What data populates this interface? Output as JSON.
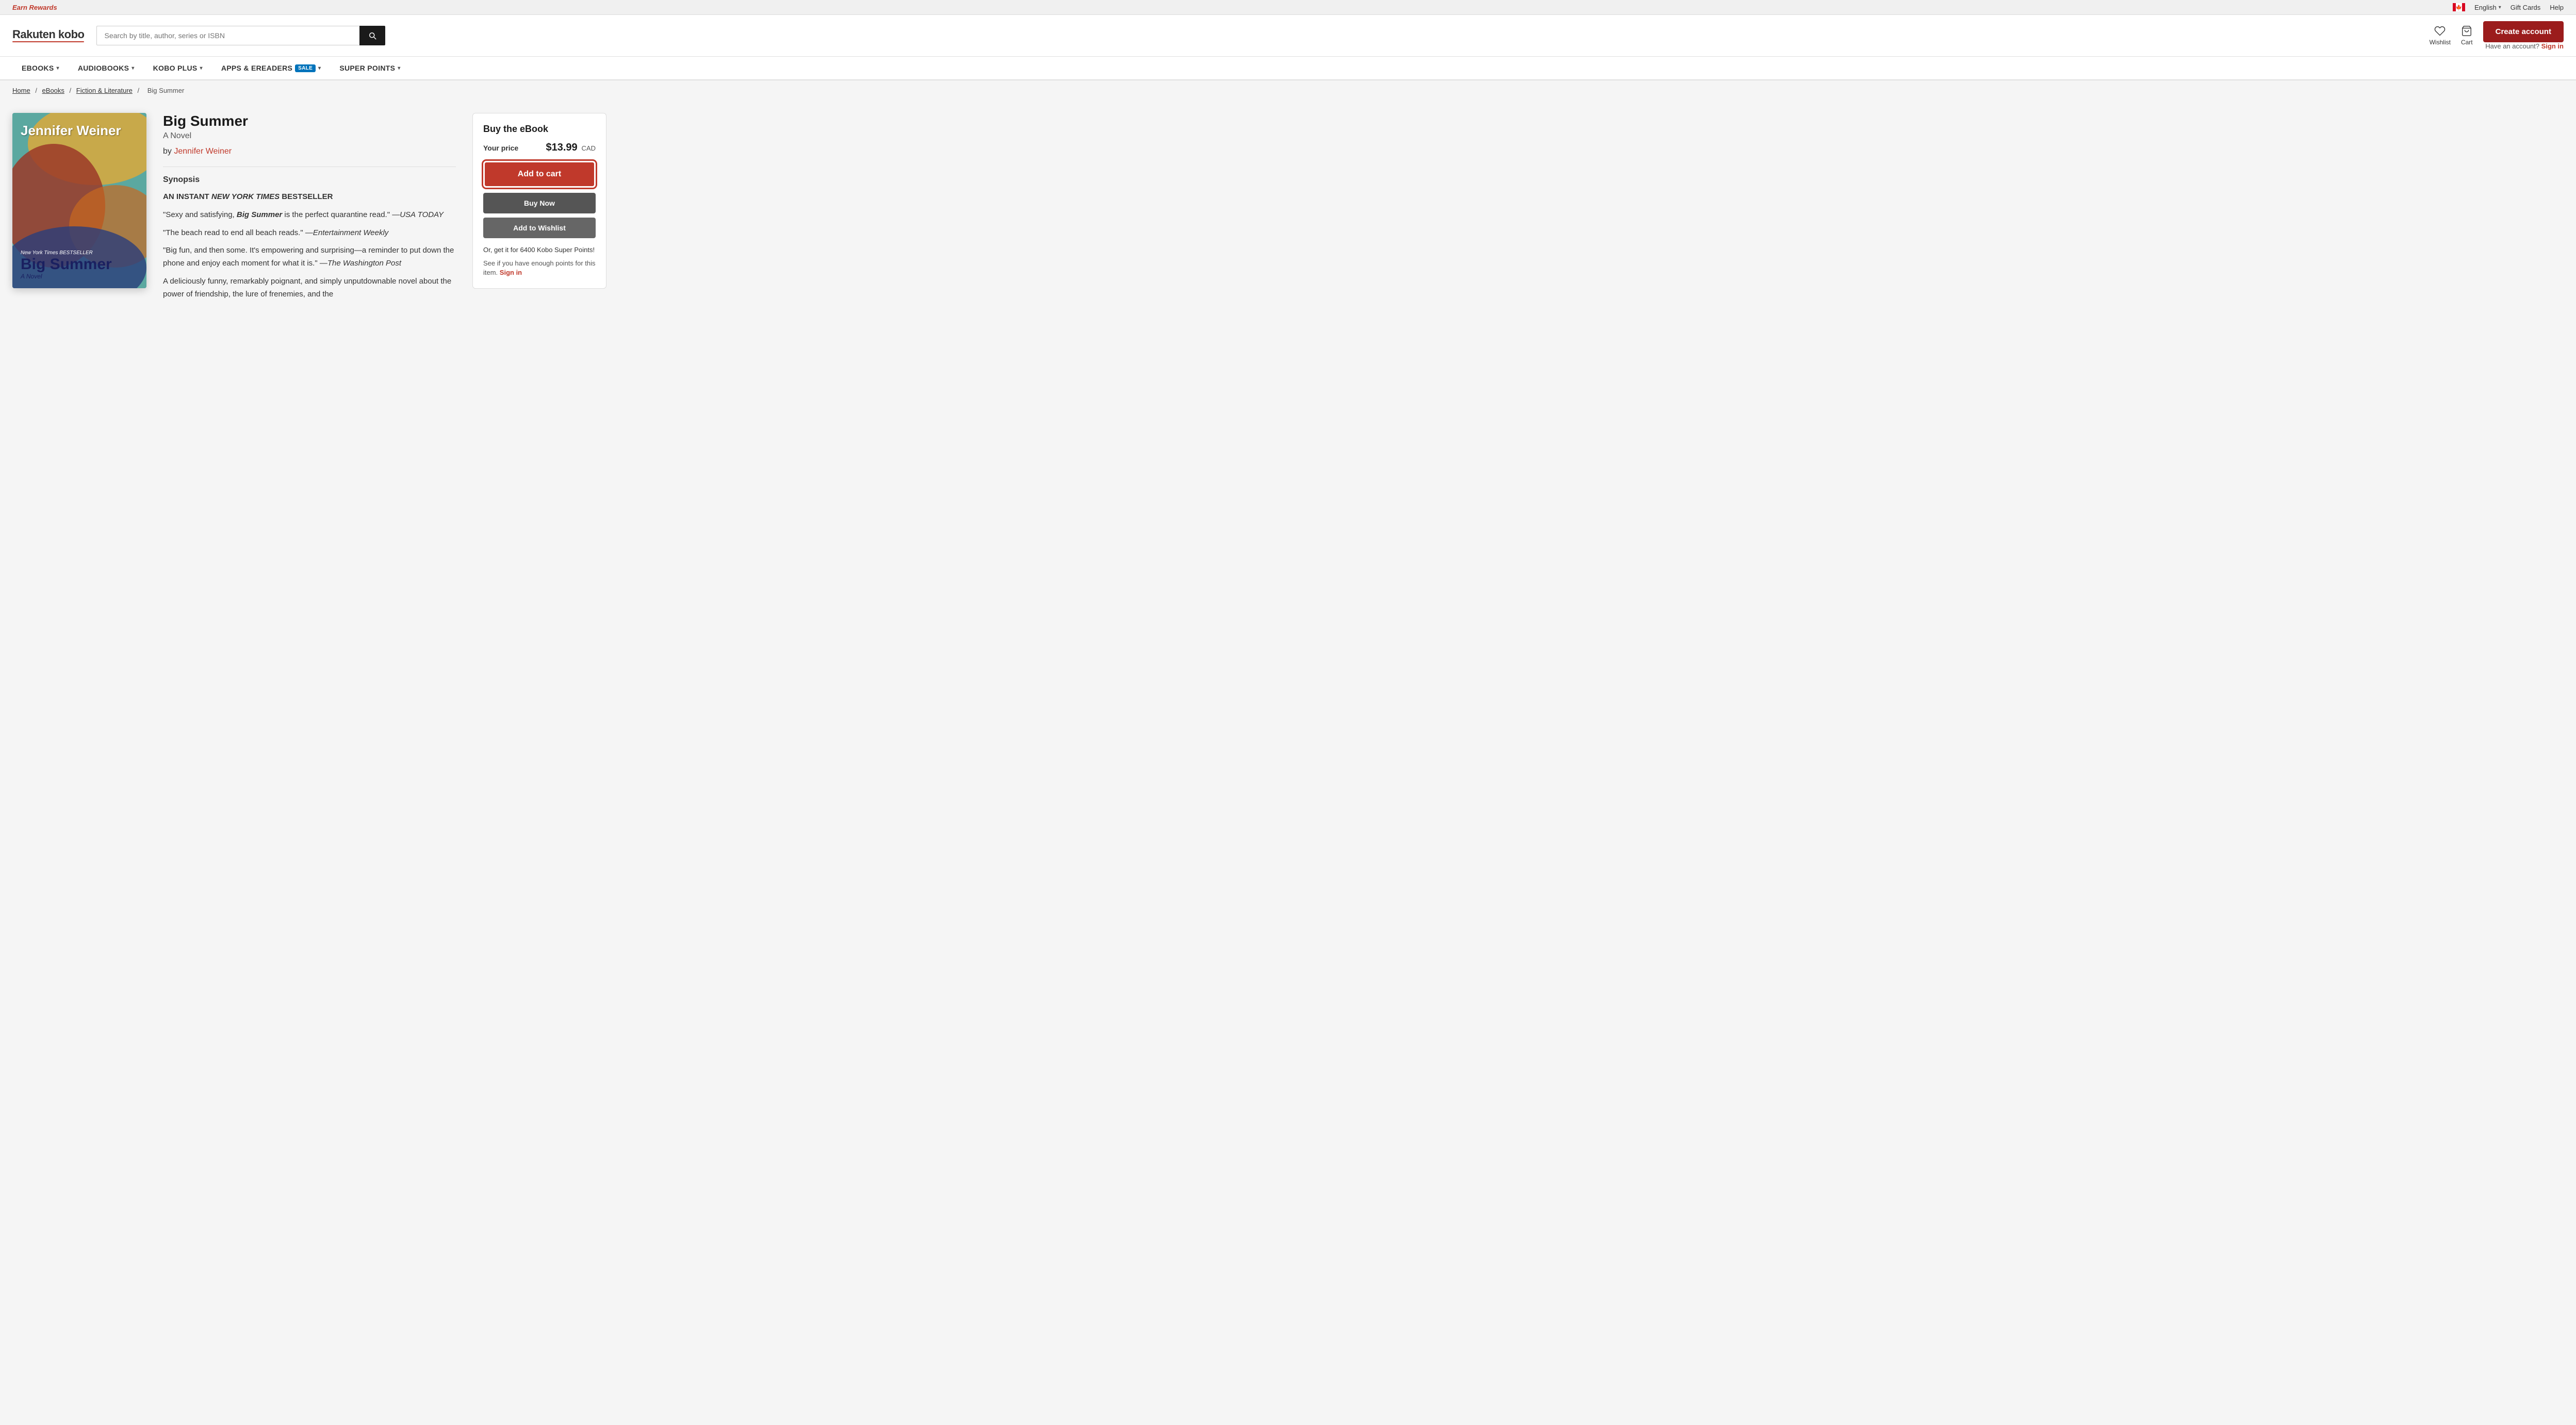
{
  "topbar": {
    "earn_rewards": "Earn Rewards",
    "language": "English",
    "gift_cards": "Gift Cards",
    "help": "Help"
  },
  "header": {
    "logo_rakuten": "Rakuten",
    "logo_kobo": "kobo",
    "search_placeholder": "Search by title, author, series or ISBN",
    "wishlist_label": "Wishlist",
    "cart_label": "Cart",
    "create_account": "Create account",
    "have_account": "Have an account?",
    "sign_in": "Sign in"
  },
  "nav": {
    "items": [
      {
        "label": "eBOOKS",
        "has_dropdown": true
      },
      {
        "label": "AUDIOBOOKS",
        "has_dropdown": true
      },
      {
        "label": "KOBO PLUS",
        "has_dropdown": true
      },
      {
        "label": "APPS & eREADERS",
        "has_dropdown": true,
        "badge": "SALE"
      },
      {
        "label": "SUPER POINTS",
        "has_dropdown": true
      }
    ]
  },
  "breadcrumb": {
    "home": "Home",
    "ebooks": "eBooks",
    "category": "Fiction & Literature",
    "current": "Big Summer"
  },
  "book": {
    "title": "Big Summer",
    "subtitle": "A Novel",
    "by": "by",
    "author": "Jennifer Weiner",
    "synopsis_label": "Synopsis",
    "cover_author": "Jennifer Weiner",
    "cover_nyt": "New York Times BESTSELLER",
    "cover_title": "Big Summer",
    "cover_novel": "A Novel",
    "synopsis": [
      "AN INSTANT NEW YORK TIMES BESTSELLER",
      "“Sexy and satisfying, Big Summer is the perfect quarantine read.” —USA TODAY",
      "“The beach read to end all beach reads.” —Entertainment Weekly",
      "“Big fun, and then some. It’s empowering and surprising—a reminder to put down the phone and enjoy each moment for what it is.” —The Washington Post",
      "A deliciously funny, remarkably poignant, and simply unputdownable novel about the power of friendship, the lure of frenemies, and the"
    ]
  },
  "buy_panel": {
    "title": "Buy the eBook",
    "your_price": "Your price",
    "price": "$13.99",
    "currency": "CAD",
    "add_to_cart": "Add to cart",
    "buy_now": "Buy Now",
    "add_to_wishlist": "Add to Wishlist",
    "super_points_text": "Or, get it for 6400 Kobo Super Points!",
    "sign_in_prompt": "See if you have enough points for this item.",
    "sign_in": "Sign in"
  }
}
